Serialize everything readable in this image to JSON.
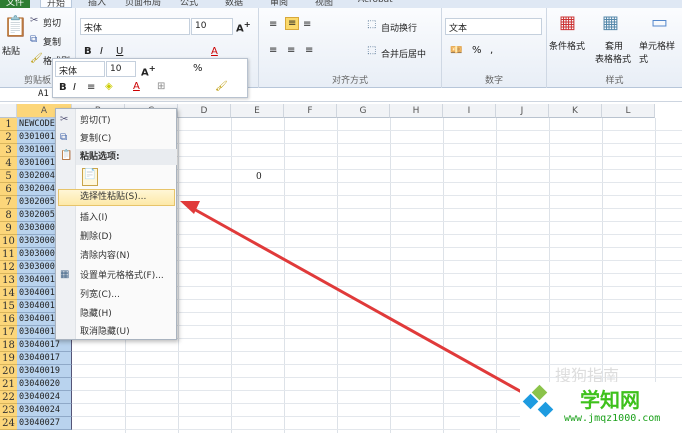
{
  "tabs": [
    "文件",
    "开始",
    "插入",
    "页面布局",
    "公式",
    "数据",
    "审阅",
    "视图",
    "Acrobat"
  ],
  "ribbon": {
    "clipboard": {
      "paste": "粘贴",
      "cut": "剪切",
      "copy": "复制",
      "format_painter": "格式刷",
      "label": "剪贴板"
    },
    "font": {
      "name": "宋体",
      "size": "10"
    },
    "alignment": {
      "wrap": "自动换行",
      "merge": "合并后居中",
      "label": "对齐方式"
    },
    "number": {
      "format": "文本",
      "label": "数字"
    },
    "styles": {
      "conditional": "条件格式",
      "table1": "套用",
      "table2": "表格格式",
      "cell": "单元格样式",
      "label": "样式"
    }
  },
  "mini_toolbar": {
    "font": "宋体",
    "size": "10"
  },
  "name_box": "A1",
  "columns": [
    "A",
    "B",
    "C",
    "D",
    "E",
    "F",
    "G",
    "H",
    "I",
    "J",
    "K",
    "L"
  ],
  "rows": [
    "1",
    "2",
    "3",
    "4",
    "5",
    "6",
    "7",
    "8",
    "9",
    "10",
    "11",
    "12",
    "13",
    "14",
    "15",
    "16",
    "17",
    "18",
    "19",
    "20",
    "21",
    "22",
    "23",
    "24"
  ],
  "col_a": [
    "NEWCODE",
    "0301001",
    "0301001",
    "0301001",
    "0302004",
    "0302004",
    "0302005",
    "0302005",
    "0303000",
    "0303000",
    "0303000",
    "0303000",
    "0304001",
    "0304001",
    "0304001",
    "0304001",
    "0304001",
    "03040017",
    "03040017",
    "03040019",
    "03040020",
    "03040024",
    "03040024",
    "03040027"
  ],
  "cell_e5": "0",
  "context_menu": [
    "剪切(T)",
    "复制(C)",
    "粘贴选项:",
    "选择性粘贴(S)...",
    "插入(I)",
    "删除(D)",
    "清除内容(N)",
    "设置单元格格式(F)...",
    "列宽(C)...",
    "隐藏(H)",
    "取消隐藏(U)"
  ],
  "watermark": {
    "site": "学知网",
    "url": "www.jmqz1000.com",
    "faded": "搜狗指南"
  },
  "colors": {
    "arrow": "#e03a3a",
    "row_header": "#fcd67a",
    "selection": "#b9d3ee"
  }
}
